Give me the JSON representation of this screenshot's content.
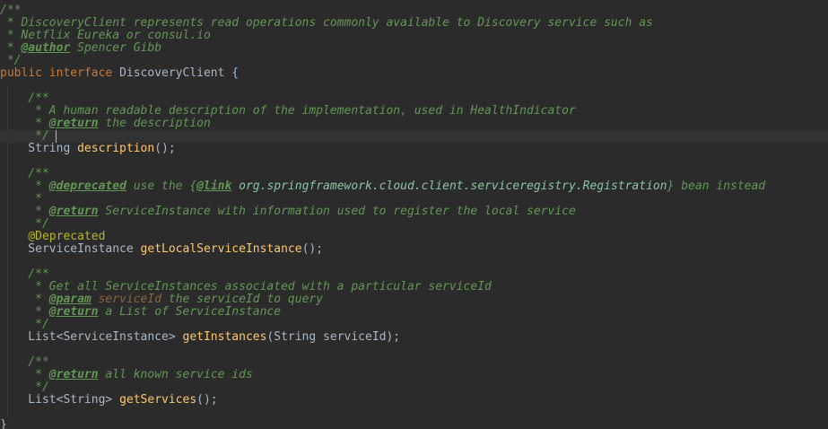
{
  "colors": {
    "background": "#2b2b2b",
    "current_line": "#323232",
    "keyword": "#cc7832",
    "plain": "#a9b7c6",
    "method": "#ffc66d",
    "javadoc": "#629755",
    "javadoc_param": "#8a653b",
    "annotation": "#bbb529"
  },
  "code": {
    "lines": [
      {
        "kind": "doc",
        "tokens": [
          {
            "t": "doc",
            "v": "/**"
          }
        ]
      },
      {
        "kind": "doc",
        "tokens": [
          {
            "t": "doc",
            "v": " * DiscoveryClient represents read operations commonly available to Discovery service such as"
          }
        ]
      },
      {
        "kind": "doc",
        "tokens": [
          {
            "t": "doc",
            "v": " * Netflix Eureka or consul.io"
          }
        ]
      },
      {
        "kind": "doc",
        "tokens": [
          {
            "t": "doc",
            "v": " * "
          },
          {
            "t": "doctag",
            "v": "@author"
          },
          {
            "t": "doc",
            "v": " Spencer Gibb"
          }
        ]
      },
      {
        "kind": "doc",
        "tokens": [
          {
            "t": "doc",
            "v": " */"
          }
        ]
      },
      {
        "kind": "code",
        "tokens": [
          {
            "t": "kw",
            "v": "public interface "
          },
          {
            "t": "plain",
            "v": "DiscoveryClient {"
          }
        ]
      },
      {
        "kind": "blank",
        "tokens": []
      },
      {
        "kind": "doc",
        "tokens": [
          {
            "t": "doc",
            "v": "    /**"
          }
        ]
      },
      {
        "kind": "doc",
        "tokens": [
          {
            "t": "doc",
            "v": "     * A human readable description of the implementation, used in HealthIndicator"
          }
        ]
      },
      {
        "kind": "doc",
        "tokens": [
          {
            "t": "doc",
            "v": "     * "
          },
          {
            "t": "doctag",
            "v": "@return"
          },
          {
            "t": "doc",
            "v": " the description"
          }
        ]
      },
      {
        "kind": "doc",
        "tokens": [
          {
            "t": "doc",
            "v": "     */"
          }
        ]
      },
      {
        "kind": "code",
        "tokens": [
          {
            "t": "plain",
            "v": "    String "
          },
          {
            "t": "method",
            "v": "description"
          },
          {
            "t": "plain",
            "v": "();"
          }
        ]
      },
      {
        "kind": "blank",
        "tokens": []
      },
      {
        "kind": "doc",
        "tokens": [
          {
            "t": "doc",
            "v": "    /**"
          }
        ]
      },
      {
        "kind": "doc",
        "tokens": [
          {
            "t": "doc",
            "v": "     * "
          },
          {
            "t": "doctag",
            "v": "@deprecated"
          },
          {
            "t": "doc",
            "v": " use the {"
          },
          {
            "t": "doctag",
            "v": "@link"
          },
          {
            "t": "doclink",
            "v": " org.springframework.cloud.client.serviceregistry.Registration"
          },
          {
            "t": "doc",
            "v": "} bean instead"
          }
        ]
      },
      {
        "kind": "doc",
        "tokens": [
          {
            "t": "doc",
            "v": "     *"
          }
        ]
      },
      {
        "kind": "doc",
        "tokens": [
          {
            "t": "doc",
            "v": "     * "
          },
          {
            "t": "doctag",
            "v": "@return"
          },
          {
            "t": "doc",
            "v": " ServiceInstance with information used to register the local service"
          }
        ]
      },
      {
        "kind": "doc",
        "tokens": [
          {
            "t": "doc",
            "v": "     */"
          }
        ]
      },
      {
        "kind": "code",
        "tokens": [
          {
            "t": "annot",
            "v": "    @Deprecated"
          }
        ]
      },
      {
        "kind": "code",
        "tokens": [
          {
            "t": "plain",
            "v": "    ServiceInstance "
          },
          {
            "t": "method",
            "v": "getLocalServiceInstance"
          },
          {
            "t": "plain",
            "v": "();"
          }
        ]
      },
      {
        "kind": "blank",
        "tokens": []
      },
      {
        "kind": "doc",
        "tokens": [
          {
            "t": "doc",
            "v": "    /**"
          }
        ]
      },
      {
        "kind": "doc",
        "tokens": [
          {
            "t": "doc",
            "v": "     * Get all ServiceInstances associated with a particular serviceId"
          }
        ]
      },
      {
        "kind": "doc",
        "tokens": [
          {
            "t": "doc",
            "v": "     * "
          },
          {
            "t": "doctag",
            "v": "@param"
          },
          {
            "t": "docparam",
            "v": " serviceId"
          },
          {
            "t": "doc",
            "v": " the serviceId to query"
          }
        ]
      },
      {
        "kind": "doc",
        "tokens": [
          {
            "t": "doc",
            "v": "     * "
          },
          {
            "t": "doctag",
            "v": "@return"
          },
          {
            "t": "doc",
            "v": " a List of ServiceInstance"
          }
        ]
      },
      {
        "kind": "doc",
        "tokens": [
          {
            "t": "doc",
            "v": "     */"
          }
        ]
      },
      {
        "kind": "code",
        "tokens": [
          {
            "t": "plain",
            "v": "    List<ServiceInstance> "
          },
          {
            "t": "method",
            "v": "getInstances"
          },
          {
            "t": "plain",
            "v": "(String serviceId);"
          }
        ]
      },
      {
        "kind": "blank",
        "tokens": []
      },
      {
        "kind": "doc",
        "tokens": [
          {
            "t": "doc",
            "v": "    /**"
          }
        ]
      },
      {
        "kind": "doc",
        "tokens": [
          {
            "t": "doc",
            "v": "     * "
          },
          {
            "t": "doctag",
            "v": "@return"
          },
          {
            "t": "doc",
            "v": " all known service ids"
          }
        ]
      },
      {
        "kind": "doc",
        "tokens": [
          {
            "t": "doc",
            "v": "     */"
          }
        ]
      },
      {
        "kind": "code",
        "tokens": [
          {
            "t": "plain",
            "v": "    List<String> "
          },
          {
            "t": "method",
            "v": "getServices"
          },
          {
            "t": "plain",
            "v": "();"
          }
        ]
      },
      {
        "kind": "blank",
        "tokens": []
      },
      {
        "kind": "code",
        "tokens": [
          {
            "t": "plain",
            "v": "}"
          }
        ]
      }
    ]
  }
}
